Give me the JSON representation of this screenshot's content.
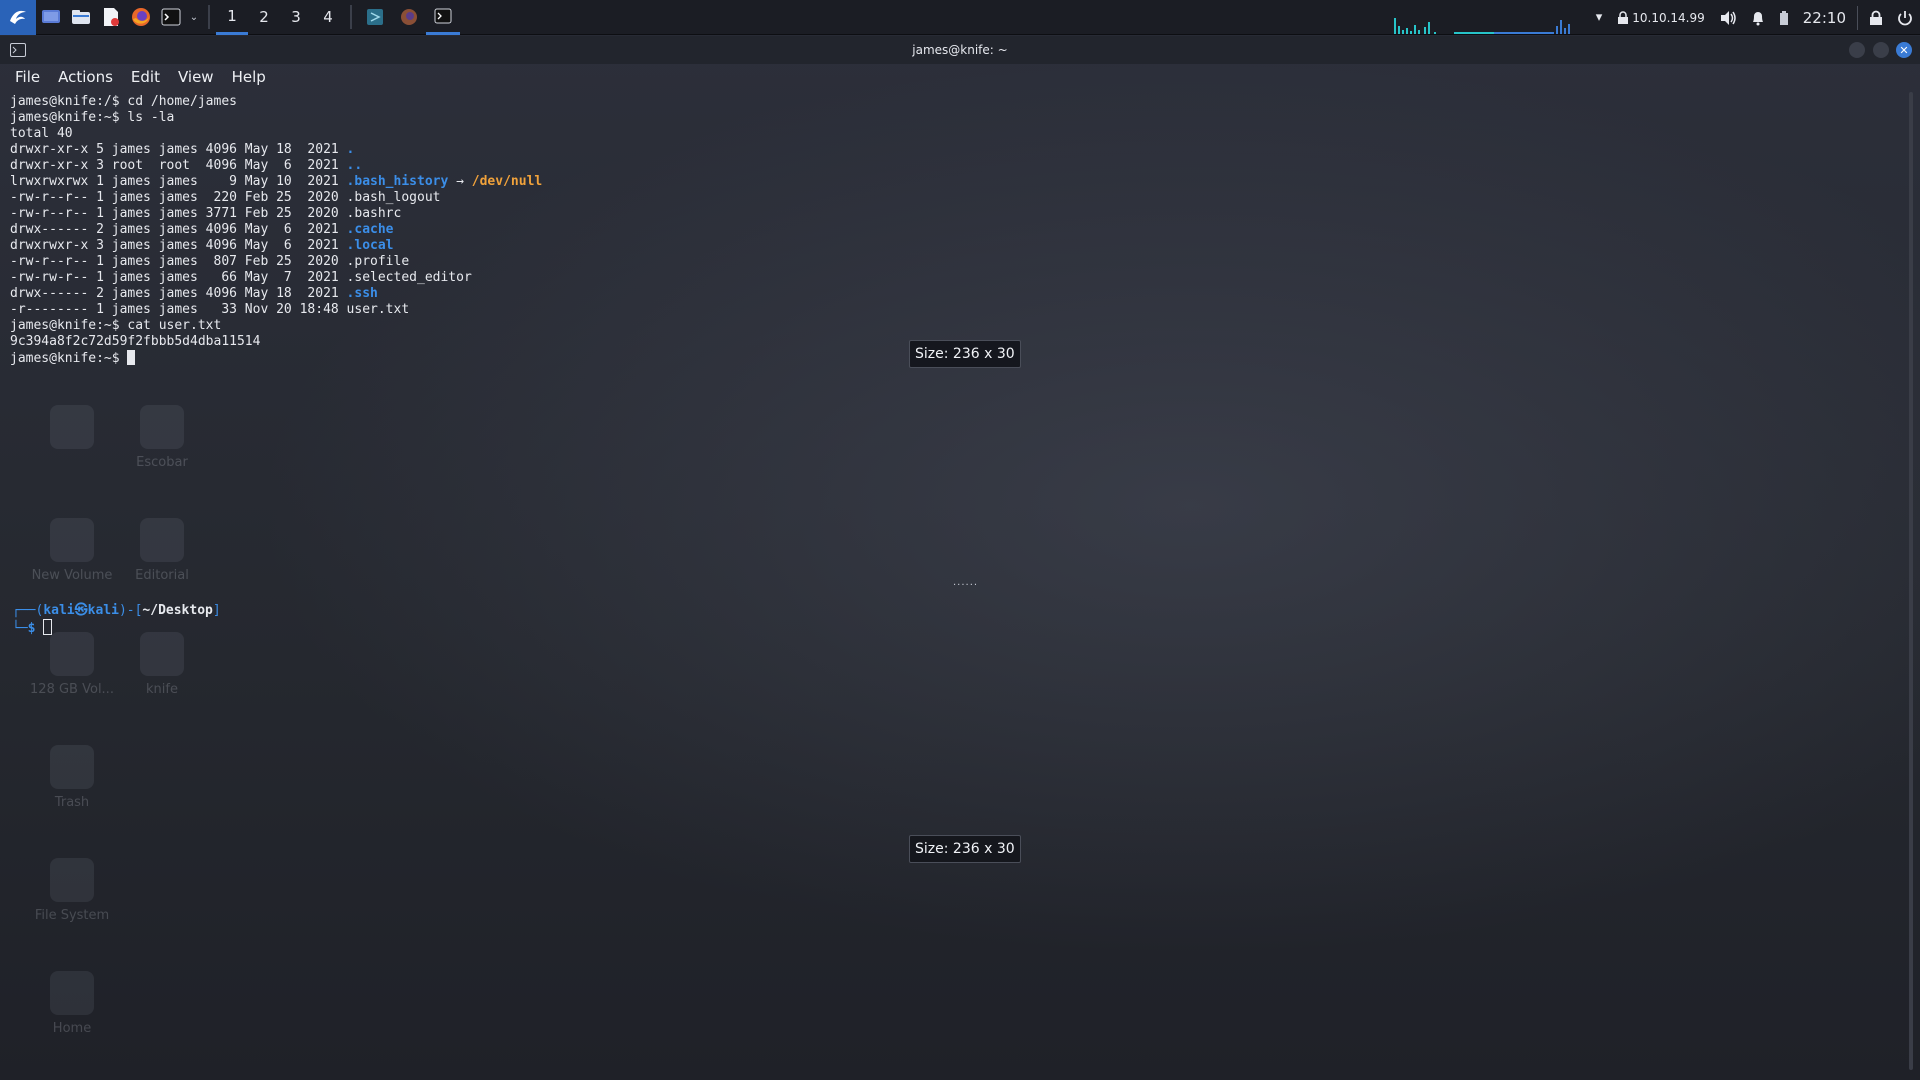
{
  "panel": {
    "workspaces": [
      "1",
      "2",
      "3",
      "4"
    ],
    "active_workspace": "1",
    "ip": "10.10.14.99",
    "clock": "22:10"
  },
  "desktop_icons": [
    {
      "label": "",
      "name": "desktop-icon-1"
    },
    {
      "label": "Escobar",
      "name": "desktop-icon-escobar"
    },
    {
      "label": "New Volume",
      "name": "desktop-icon-new-volume"
    },
    {
      "label": "Editorial",
      "name": "desktop-icon-editorial"
    },
    {
      "label": "128 GB Vol...",
      "name": "desktop-icon-128gb"
    },
    {
      "label": "knife",
      "name": "desktop-icon-knife"
    },
    {
      "label": "Trash",
      "name": "desktop-icon-trash"
    },
    {
      "label": "File System",
      "name": "desktop-icon-filesystem"
    },
    {
      "label": "Home",
      "name": "desktop-icon-home"
    }
  ],
  "window": {
    "title": "james@knife: ~",
    "menu": [
      "File",
      "Actions",
      "Edit",
      "View",
      "Help"
    ]
  },
  "terminal": {
    "lines": [
      [
        {
          "t": "james@knife:/$ cd /home/james"
        }
      ],
      [
        {
          "t": "james@knife:~$ ls -la"
        }
      ],
      [
        {
          "t": "total 40"
        }
      ],
      [
        {
          "t": "drwxr-xr-x 5 james james 4096 May 18  2021 "
        },
        {
          "t": ".",
          "c": "blue"
        }
      ],
      [
        {
          "t": "drwxr-xr-x 3 root  root  4096 May  6  2021 "
        },
        {
          "t": "..",
          "c": "blue"
        }
      ],
      [
        {
          "t": "lrwxrwxrwx 1 james james    9 May 10  2021 "
        },
        {
          "t": ".bash_history",
          "c": "blue"
        },
        {
          "t": " → "
        },
        {
          "t": "/dev/null",
          "c": "orange"
        }
      ],
      [
        {
          "t": "-rw-r--r-- 1 james james  220 Feb 25  2020 .bash_logout"
        }
      ],
      [
        {
          "t": "-rw-r--r-- 1 james james 3771 Feb 25  2020 .bashrc"
        }
      ],
      [
        {
          "t": "drwx------ 2 james james 4096 May  6  2021 "
        },
        {
          "t": ".cache",
          "c": "blue"
        }
      ],
      [
        {
          "t": "drwxrwxr-x 3 james james 4096 May  6  2021 "
        },
        {
          "t": ".local",
          "c": "blue"
        }
      ],
      [
        {
          "t": "-rw-r--r-- 1 james james  807 Feb 25  2020 .profile"
        }
      ],
      [
        {
          "t": "-rw-rw-r-- 1 james james   66 May  7  2021 .selected_editor"
        }
      ],
      [
        {
          "t": "drwx------ 2 james james 4096 May 18  2021 "
        },
        {
          "t": ".ssh",
          "c": "blue"
        }
      ],
      [
        {
          "t": "-r-------- 1 james james   33 Nov 20 18:48 user.txt"
        }
      ],
      [
        {
          "t": "james@knife:~$ cat user.txt"
        }
      ],
      [
        {
          "t": "9c394a8f2c72d59f2fbbb5d4dba11514"
        }
      ],
      [
        {
          "t": "james@knife:~$ "
        }
      ]
    ]
  },
  "size_tips": [
    "Size: 236 x 30",
    "Size: 236 x 30"
  ],
  "resize_handle": "......",
  "second_prompt": {
    "line1_open": "┌──(",
    "user": "kali㉿kali",
    "line1_mid": ")-[",
    "path": "~/Desktop",
    "line1_close": "]",
    "line2": "└─$ "
  }
}
